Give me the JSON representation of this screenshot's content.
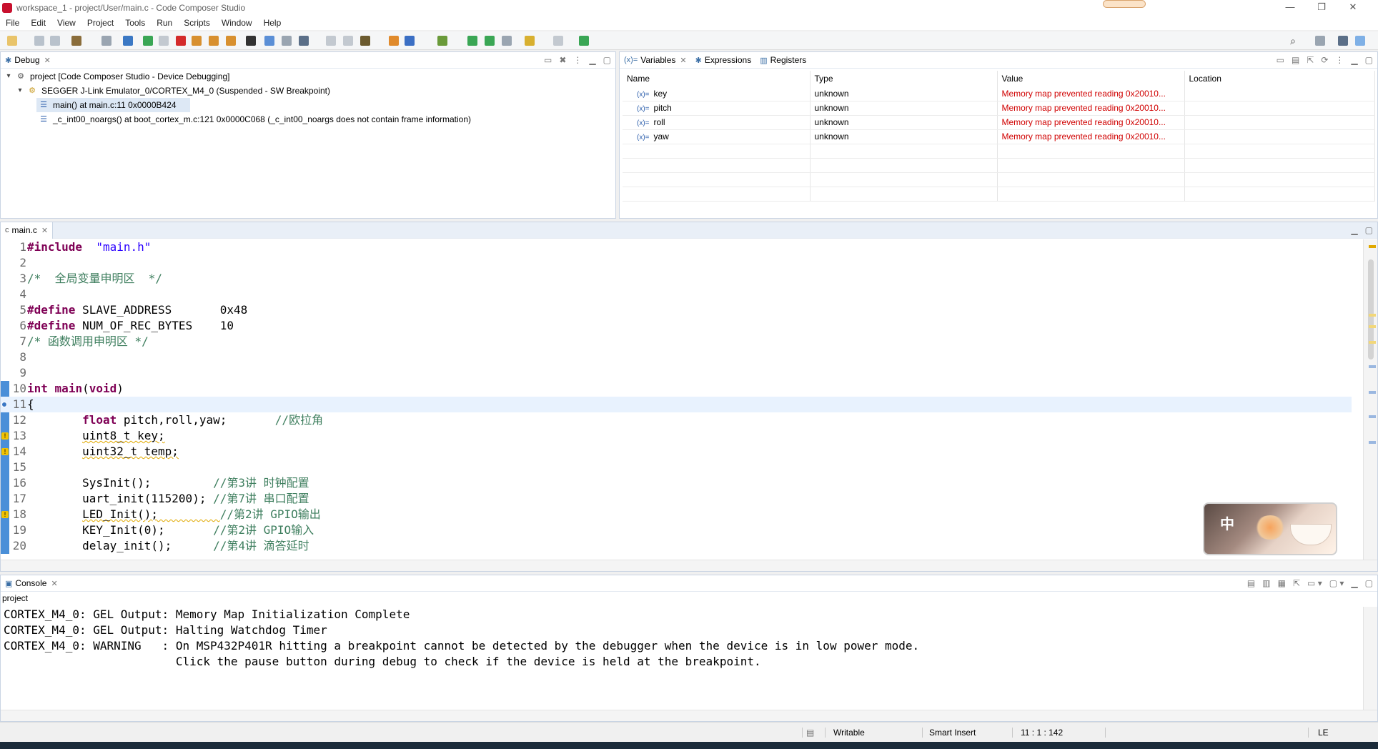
{
  "window": {
    "title": "workspace_1 - project/User/main.c - Code Composer Studio",
    "controls": {
      "minimize": "—",
      "restore": "❐",
      "close": "✕"
    }
  },
  "menu": [
    "File",
    "Edit",
    "View",
    "Project",
    "Tools",
    "Run",
    "Scripts",
    "Window",
    "Help"
  ],
  "debug_view": {
    "tab_label": "Debug",
    "tree": [
      {
        "label": "project [Code Composer Studio - Device Debugging]"
      },
      {
        "label": "SEGGER J-Link Emulator_0/CORTEX_M4_0 (Suspended - SW Breakpoint)"
      },
      {
        "label": "main() at main.c:11 0x0000B424"
      },
      {
        "label": "_c_int00_noargs() at boot_cortex_m.c:121 0x0000C068  (_c_int00_noargs does not contain frame information)"
      }
    ]
  },
  "variables_view": {
    "tabs": [
      "Variables",
      "Expressions",
      "Registers"
    ],
    "columns": [
      "Name",
      "Type",
      "Value",
      "Location"
    ],
    "rows": [
      {
        "name": "key",
        "type": "unknown",
        "value": "Memory map prevented reading 0x20010...",
        "location": ""
      },
      {
        "name": "pitch",
        "type": "unknown",
        "value": "Memory map prevented reading 0x20010...",
        "location": ""
      },
      {
        "name": "roll",
        "type": "unknown",
        "value": "Memory map prevented reading 0x20010...",
        "location": ""
      },
      {
        "name": "yaw",
        "type": "unknown",
        "value": "Memory map prevented reading 0x20010...",
        "location": ""
      }
    ]
  },
  "editor": {
    "tab_label": "main.c",
    "lines": [
      {
        "n": "1",
        "parts": [
          [
            "kw",
            "#include"
          ],
          [
            "",
            "  "
          ],
          [
            "str",
            "\"main.h\""
          ]
        ]
      },
      {
        "n": "2",
        "parts": []
      },
      {
        "n": "3",
        "parts": [
          [
            "cmt",
            "/*  全局变量申明区  */"
          ]
        ]
      },
      {
        "n": "4",
        "parts": []
      },
      {
        "n": "5",
        "parts": [
          [
            "kw",
            "#define"
          ],
          [
            "",
            " SLAVE_ADDRESS       0x48"
          ]
        ]
      },
      {
        "n": "6",
        "parts": [
          [
            "kw",
            "#define"
          ],
          [
            "",
            " NUM_OF_REC_BYTES    10"
          ]
        ]
      },
      {
        "n": "7",
        "parts": [
          [
            "cmt",
            "/* 函数调用申明区 */"
          ]
        ]
      },
      {
        "n": "8",
        "parts": []
      },
      {
        "n": "9",
        "parts": []
      },
      {
        "n": "10",
        "parts": [
          [
            "kw",
            "int"
          ],
          [
            "",
            " "
          ],
          [
            "kw",
            "main"
          ],
          [
            "",
            "("
          ],
          [
            "kw",
            "void"
          ],
          [
            "",
            ")"
          ]
        ]
      },
      {
        "n": "11",
        "parts": [
          [
            "",
            "{"
          ]
        ]
      },
      {
        "n": "12",
        "parts": [
          [
            "",
            "        "
          ],
          [
            "kw",
            "float"
          ],
          [
            "",
            " pitch,roll,yaw;       "
          ],
          [
            "cmt",
            "//欧拉角"
          ]
        ]
      },
      {
        "n": "13",
        "parts": [
          [
            "",
            "        "
          ],
          [
            "sq",
            "uint8_t key;"
          ]
        ]
      },
      {
        "n": "14",
        "parts": [
          [
            "",
            "        "
          ],
          [
            "sq",
            "uint32_t temp;"
          ]
        ]
      },
      {
        "n": "15",
        "parts": []
      },
      {
        "n": "16",
        "parts": [
          [
            "",
            "        SysInit();         "
          ],
          [
            "cmt",
            "//第3讲 时钟配置"
          ]
        ]
      },
      {
        "n": "17",
        "parts": [
          [
            "",
            "        uart_init(115200); "
          ],
          [
            "cmt",
            "//第7讲 串口配置"
          ]
        ]
      },
      {
        "n": "18",
        "parts": [
          [
            "",
            "        "
          ],
          [
            "sq",
            "LED_Init();         "
          ],
          [
            "cmt",
            "//第2讲 GPIO输出"
          ]
        ]
      },
      {
        "n": "19",
        "parts": [
          [
            "",
            "        KEY_Init(0);       "
          ],
          [
            "cmt",
            "//第2讲 GPIO输入"
          ]
        ]
      },
      {
        "n": "20",
        "parts": [
          [
            "",
            "        delay_init();      "
          ],
          [
            "cmt",
            "//第4讲 滴答延时"
          ]
        ]
      }
    ]
  },
  "ime": {
    "label": "中"
  },
  "console": {
    "tab_label": "Console",
    "project": "project",
    "text": "CORTEX_M4_0: GEL Output: Memory Map Initialization Complete\nCORTEX_M4_0: GEL Output: Halting Watchdog Timer\nCORTEX_M4_0: WARNING   : On MSP432P401R hitting a breakpoint cannot be detected by the debugger when the device is in low power mode.\n                         Click the pause button during debug to check if the device is held at the breakpoint."
  },
  "status": {
    "writable": "Writable",
    "insert_mode": "Smart Insert",
    "position": "11 : 1 : 142",
    "encoding": "LE"
  },
  "colors": {
    "keyword": "#7f0055",
    "string": "#2a00ff",
    "comment": "#3f7f5f",
    "error": "#d00000"
  }
}
